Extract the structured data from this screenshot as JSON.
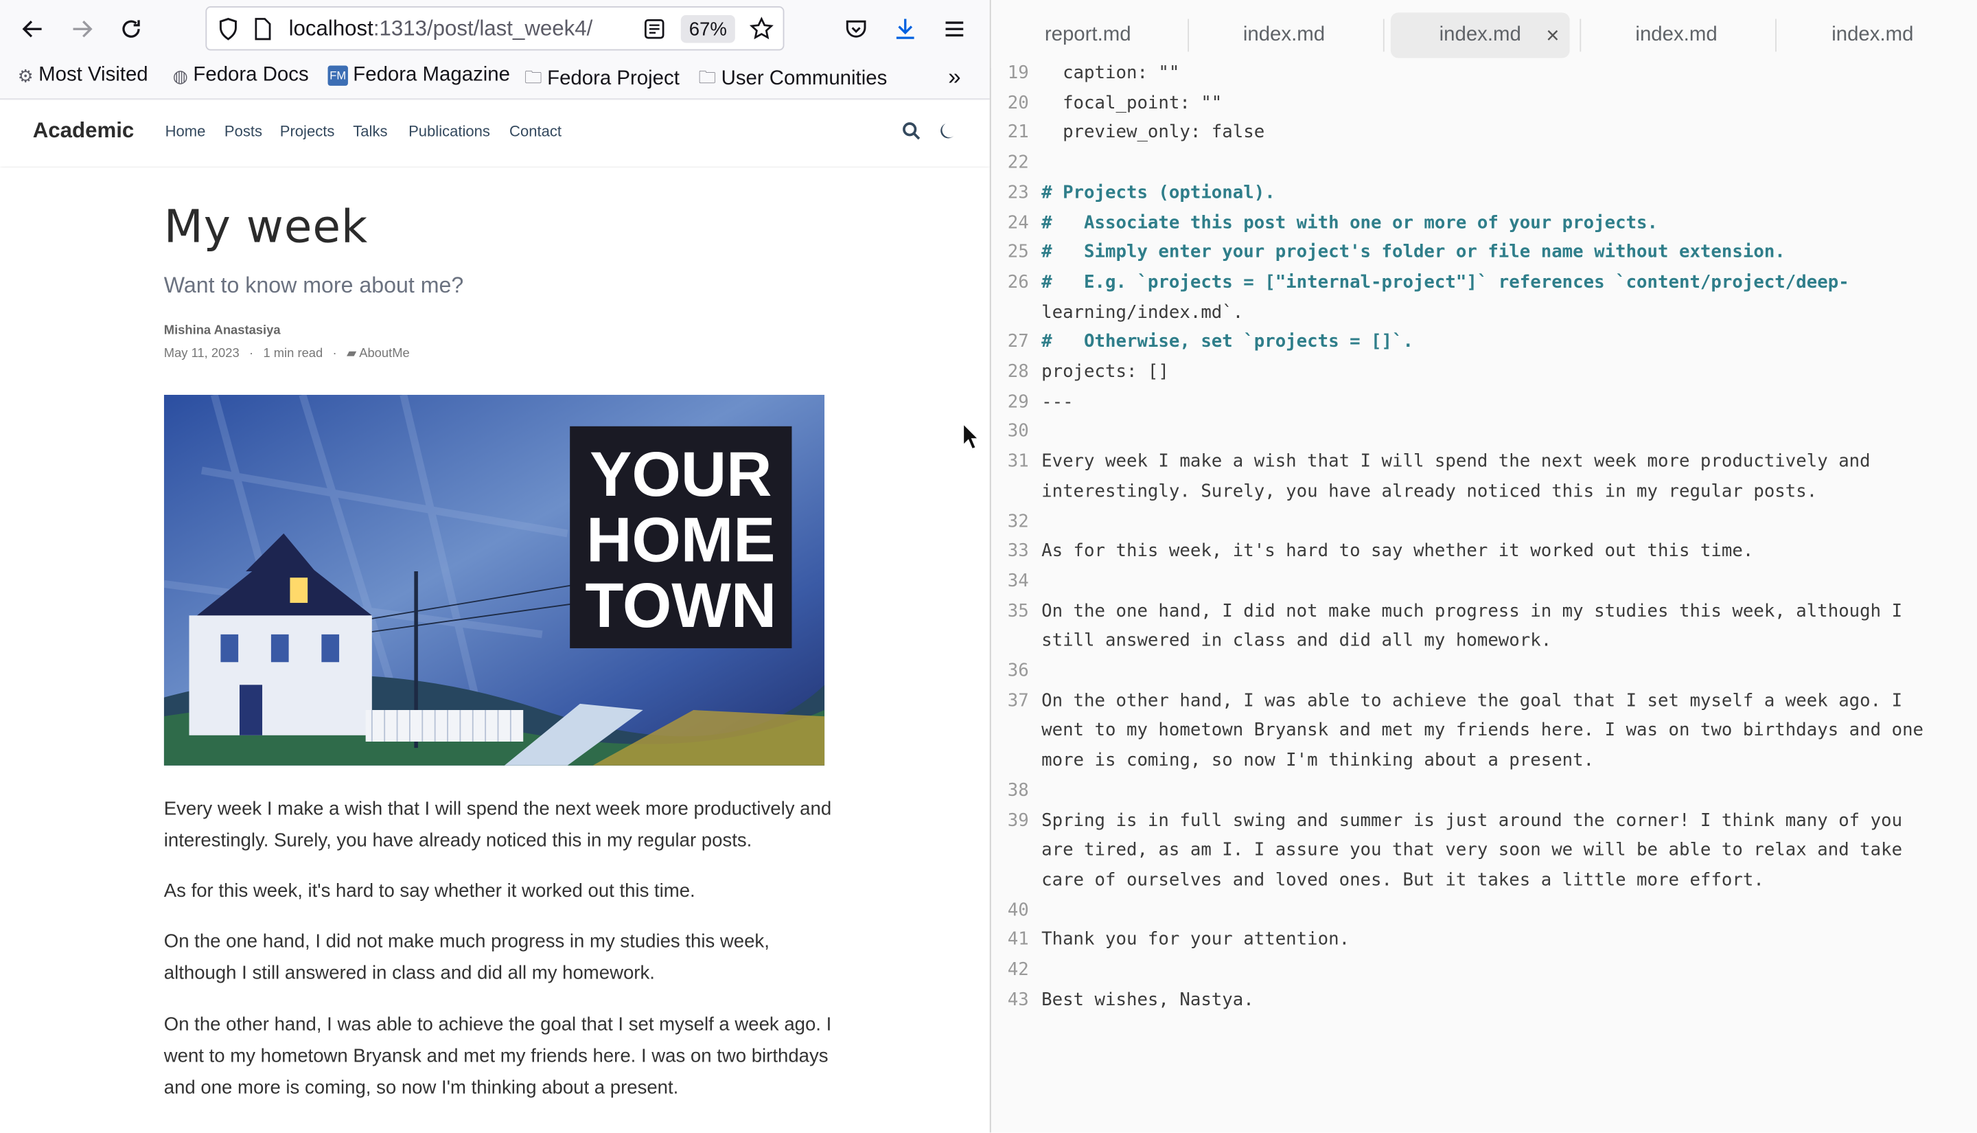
{
  "browser": {
    "url_host": "localhost",
    "url_path": ":1313/post/last_week4/",
    "zoom": "67%",
    "bookmarks": [
      "Most Visited",
      "Fedora Docs",
      "Fedora Magazine",
      "Fedora Project",
      "User Communities"
    ],
    "icons": [
      "back-icon",
      "forward-icon",
      "reload-icon",
      "shield-icon",
      "page-icon",
      "reader-icon",
      "star-icon",
      "pocket-icon",
      "download-icon",
      "menu-icon",
      "overflow-chevron-icon"
    ]
  },
  "site": {
    "brand": "Academic",
    "nav": [
      "Home",
      "Posts",
      "Projects",
      "Talks",
      "Publications",
      "Contact"
    ]
  },
  "post": {
    "title": "My week",
    "subtitle": "Want to know more about me?",
    "author": "Mishina Anastasiya",
    "date": "May 11, 2023",
    "read_time": "1 min read",
    "category": "AboutMe",
    "hero_text": [
      "YOUR",
      "HOME",
      "TOWN"
    ],
    "paragraphs": [
      "Every week I make a wish that I will spend the next week more productively and interestingly. Surely, you have already noticed this in my regular posts.",
      "As for this week, it's hard to say whether it worked out this time.",
      "On the one hand, I did not make much progress in my studies this week, although I still answered in class and did all my homework.",
      "On the other hand, I was able to achieve the goal that I set myself a week ago. I went to my hometown Bryansk and met my friends here. I was on two birthdays and one more is coming, so now I'm thinking about a present."
    ]
  },
  "editor": {
    "tabs": [
      "report.md",
      "index.md",
      "index.md",
      "index.md",
      "index.md"
    ],
    "active_tab": 2,
    "lines": [
      {
        "n": "19",
        "text": "  caption: \"\""
      },
      {
        "n": "20",
        "text": "  focal_point: \"\""
      },
      {
        "n": "21",
        "text": "  preview_only: false"
      },
      {
        "n": "22",
        "text": ""
      },
      {
        "n": "23",
        "text": "# Projects (optional)."
      },
      {
        "n": "24",
        "text": "#   Associate this post with one or more of your projects."
      },
      {
        "n": "25",
        "text": "#   Simply enter your project's folder or file name without extension."
      },
      {
        "n": "26",
        "text": "#   E.g. `projects = [\"internal-project\"]` references `content/project/deep-"
      },
      {
        "n": "",
        "text": "learning/index.md`."
      },
      {
        "n": "27",
        "text": "#   Otherwise, set `projects = []`."
      },
      {
        "n": "28",
        "text": "projects: []"
      },
      {
        "n": "29",
        "text": "---"
      },
      {
        "n": "30",
        "text": ""
      },
      {
        "n": "31",
        "text": "Every week I make a wish that I will spend the next week more productively and"
      },
      {
        "n": "",
        "text": "interestingly. Surely, you have already noticed this in my regular posts."
      },
      {
        "n": "32",
        "text": ""
      },
      {
        "n": "33",
        "text": "As for this week, it's hard to say whether it worked out this time."
      },
      {
        "n": "34",
        "text": ""
      },
      {
        "n": "35",
        "text": "On the one hand, I did not make much progress in my studies this week, although I"
      },
      {
        "n": "",
        "text": "still answered in class and did all my homework."
      },
      {
        "n": "36",
        "text": ""
      },
      {
        "n": "37",
        "text": "On the other hand, I was able to achieve the goal that I set myself a week ago. I"
      },
      {
        "n": "",
        "text": "went to my hometown Bryansk and met my friends here. I was on two birthdays and one"
      },
      {
        "n": "",
        "text": "more is coming, so now I'm thinking about a present."
      },
      {
        "n": "38",
        "text": ""
      },
      {
        "n": "39",
        "text": "Spring is in full swing and summer is just around the corner! I think many of you"
      },
      {
        "n": "",
        "text": "are tired, as am I. I assure you that very soon we will be able to relax and take"
      },
      {
        "n": "",
        "text": "care of ourselves and loved ones. But it takes a little more effort."
      },
      {
        "n": "40",
        "text": ""
      },
      {
        "n": "41",
        "text": "Thank you for your attention."
      },
      {
        "n": "42",
        "text": ""
      },
      {
        "n": "43",
        "text": "Best wishes, Nastya."
      }
    ]
  }
}
